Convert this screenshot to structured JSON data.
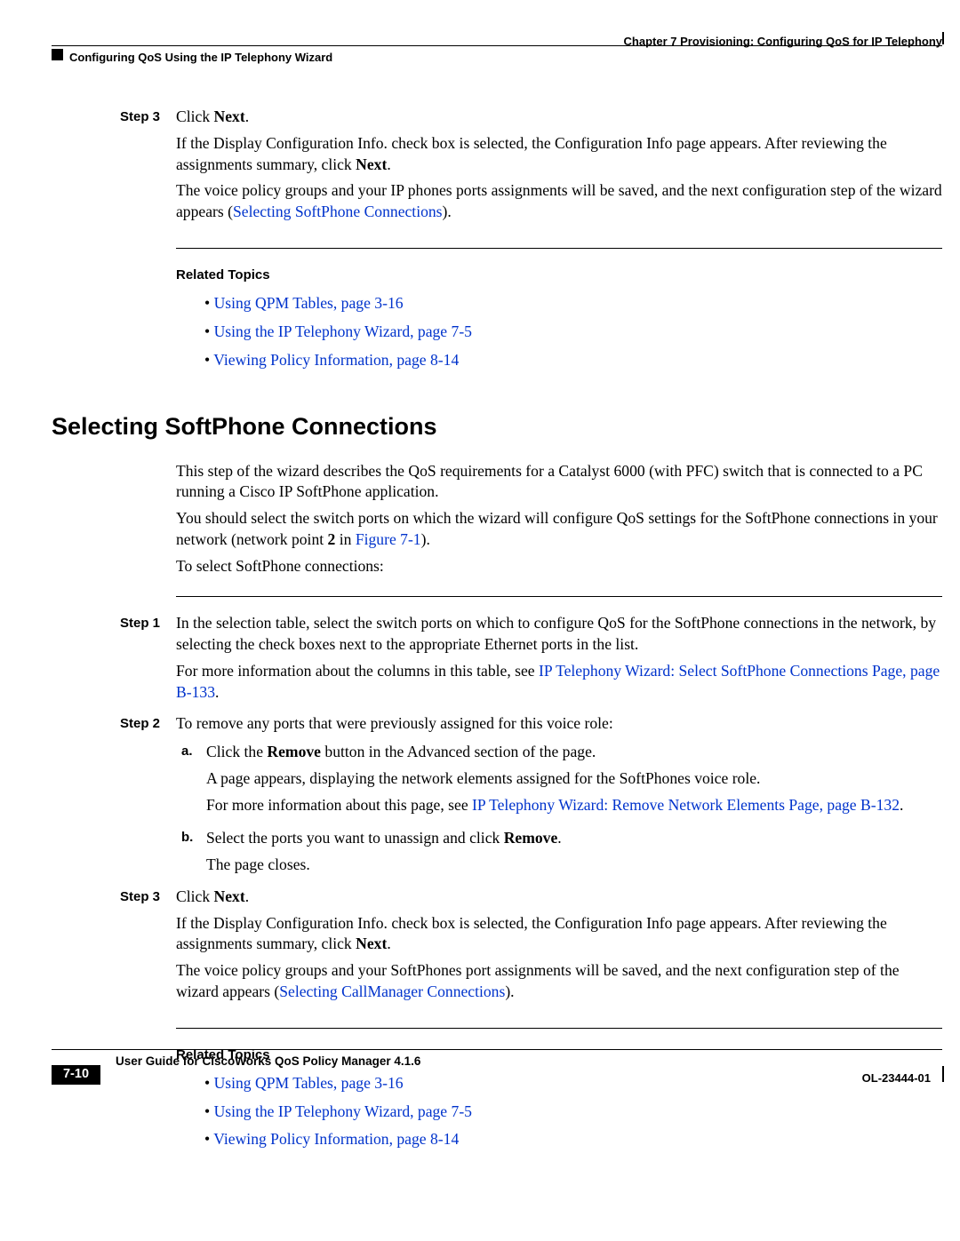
{
  "header": {
    "chapter": "Chapter 7      Provisioning: Configuring QoS for IP Telephony",
    "section": "Configuring QoS Using the IP Telephony Wizard"
  },
  "step3a": {
    "label": "Step 3",
    "click_pre": "Click ",
    "click_next": "Next",
    "click_post": ".",
    "para1_a": "If the Display Configuration Info. check box is selected, the Configuration Info page appears. After reviewing the assignments summary, click ",
    "para1_b": "Next",
    "para1_c": ".",
    "para2_a": "The voice policy groups and your IP phones ports assignments will be saved, and the next configuration step of the wizard appears (",
    "para2_link": "Selecting SoftPhone Connections",
    "para2_b": ")."
  },
  "related1": {
    "heading": "Related Topics",
    "item1": "Using QPM Tables, page 3-16",
    "item2": "Using the IP Telephony Wizard, page 7-5",
    "item3": "Viewing Policy Information, page 8-14"
  },
  "h2": "Selecting SoftPhone Connections",
  "intro": {
    "p1": "This step of the wizard describes the QoS requirements for a Catalyst 6000 (with PFC) switch that is connected to a PC running a Cisco IP SoftPhone application.",
    "p2_a": "You should select the switch ports on which the wizard will configure QoS settings for the SoftPhone connections in your network (network point ",
    "p2_bold": "2",
    "p2_b": " in ",
    "p2_link": "Figure 7-1",
    "p2_c": ").",
    "p3": "To select SoftPhone connections:"
  },
  "step1b": {
    "label": "Step 1",
    "p1": "In the selection table, select the switch ports on which to configure QoS for the SoftPhone connections in the network, by selecting the check boxes next to the appropriate Ethernet ports in the list.",
    "p2_a": "For more information about the columns in this table, see ",
    "p2_link": "IP Telephony Wizard: Select SoftPhone Connections Page, page B-133",
    "p2_b": "."
  },
  "step2b": {
    "label": "Step 2",
    "p1": "To remove any ports that were previously assigned for this voice role:",
    "a_marker": "a.",
    "a1_a": "Click the ",
    "a1_bold": "Remove",
    "a1_b": " button in the Advanced section of the page.",
    "a2": "A page appears, displaying the network elements assigned for the SoftPhones voice role.",
    "a3_a": "For more information about this page, see ",
    "a3_link": "IP Telephony Wizard: Remove Network Elements Page, page B-132",
    "a3_b": ".",
    "b_marker": "b.",
    "b1_a": "Select the ports you want to unassign and click ",
    "b1_bold": "Remove",
    "b1_b": ".",
    "b2": "The page closes."
  },
  "step3b": {
    "label": "Step 3",
    "click_pre": "Click ",
    "click_next": "Next",
    "click_post": ".",
    "p1_a": "If the Display Configuration Info. check box is selected, the Configuration Info page appears. After reviewing the assignments summary, click ",
    "p1_b": "Next",
    "p1_c": ".",
    "p2_a": "The voice policy groups and your SoftPhones port assignments will be saved, and the next configuration step of the wizard appears (",
    "p2_link": "Selecting CallManager Connections",
    "p2_b": ")."
  },
  "related2": {
    "heading": "Related Topics",
    "item1": "Using QPM Tables, page 3-16",
    "item2": "Using the IP Telephony Wizard, page 7-5",
    "item3": "Viewing Policy Information, page 8-14"
  },
  "footer": {
    "doc_title": "User Guide for CiscoWorks QoS Policy Manager 4.1.6",
    "page": "7-10",
    "doc_id": "OL-23444-01"
  }
}
